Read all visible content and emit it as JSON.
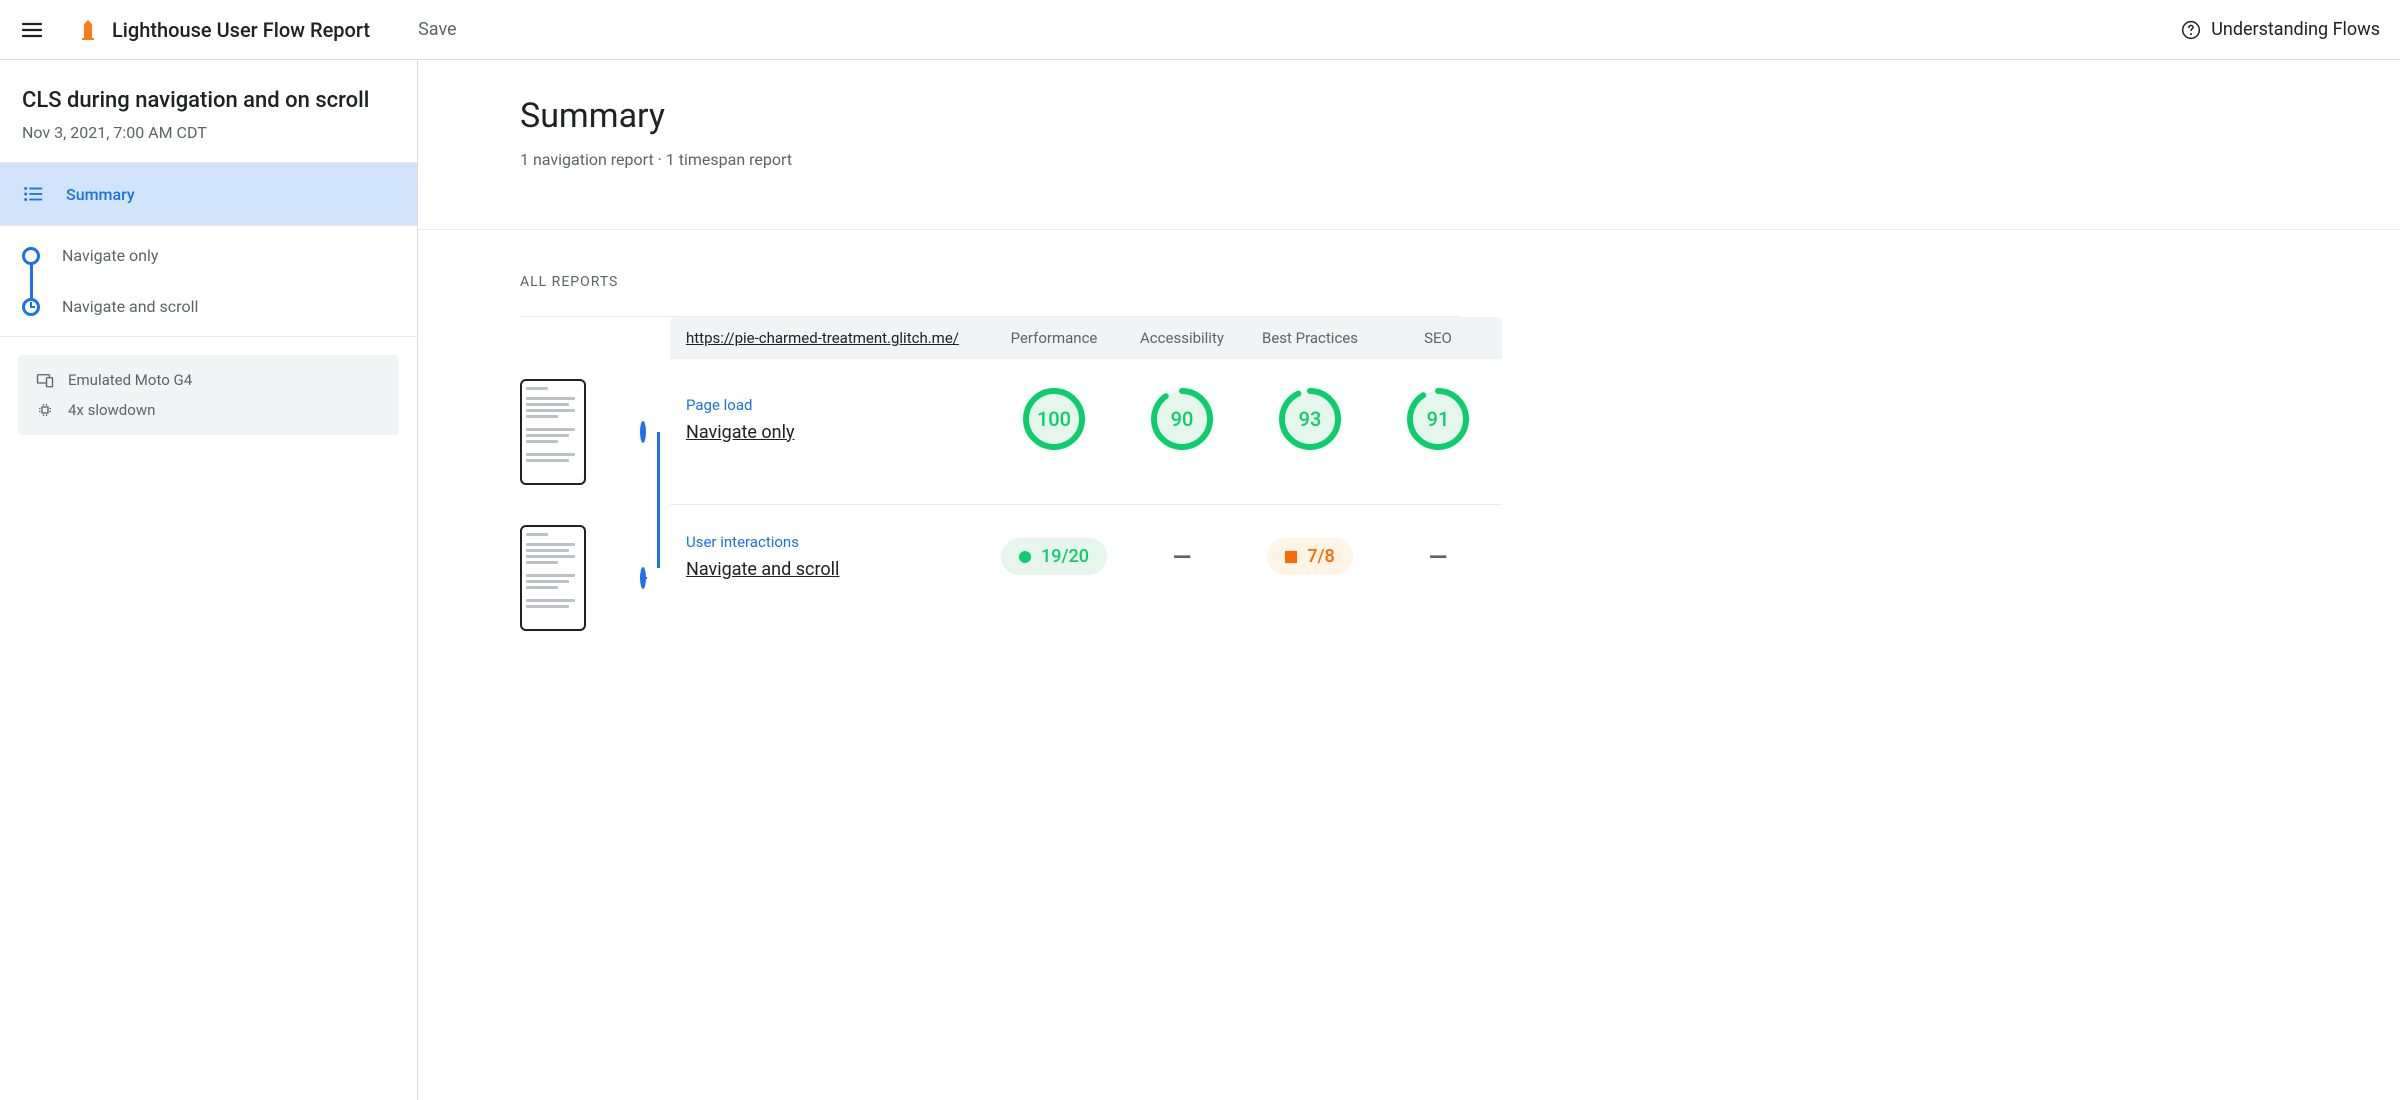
{
  "topbar": {
    "app_title": "Lighthouse User Flow Report",
    "save_label": "Save",
    "help_label": "Understanding Flows"
  },
  "sidebar": {
    "flow_name": "CLS during navigation and on scroll",
    "flow_date": "Nov 3, 2021, 7:00 AM CDT",
    "summary_label": "Summary",
    "steps": [
      {
        "label": "Navigate only",
        "kind": "navigation"
      },
      {
        "label": "Navigate and scroll",
        "kind": "timespan"
      }
    ],
    "settings": {
      "device": "Emulated Moto G4",
      "throttle": "4x slowdown"
    }
  },
  "summary": {
    "title": "Summary",
    "subtitle": "1 navigation report · 1 timespan report",
    "all_reports_label": "ALL REPORTS",
    "url": "https://pie-charmed-treatment.glitch.me/",
    "columns": {
      "perf": "Performance",
      "a11y": "Accessibility",
      "bp": "Best Practices",
      "seo": "SEO"
    },
    "rows": [
      {
        "type_label": "Page load",
        "name": "Navigate only",
        "kind": "navigation",
        "scores": {
          "perf": "100",
          "a11y": "90",
          "bp": "93",
          "seo": "91"
        },
        "score_pcts": {
          "perf": 100,
          "a11y": 90,
          "bp": 93,
          "seo": 91
        }
      },
      {
        "type_label": "User interactions",
        "name": "Navigate and scroll",
        "kind": "timespan",
        "fractions": {
          "perf": "19/20",
          "bp": "7/8"
        },
        "fraction_grades": {
          "perf": "green",
          "bp": "orange"
        }
      }
    ]
  }
}
